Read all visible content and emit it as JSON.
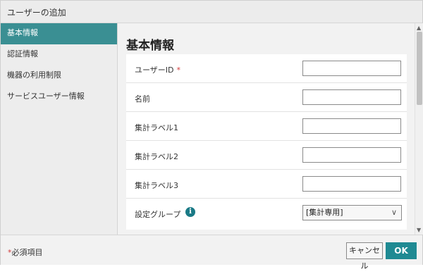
{
  "dialog": {
    "title": "ユーザーの追加"
  },
  "sidebar": {
    "items": [
      {
        "label": "基本情報",
        "active": true
      },
      {
        "label": "認証情報",
        "active": false
      },
      {
        "label": "機器の利用制限",
        "active": false
      },
      {
        "label": "サービスユーザー情報",
        "active": false
      }
    ]
  },
  "main": {
    "section_title": "基本情報",
    "fields": [
      {
        "label": "ユーザーID",
        "required_mark": "*",
        "value": ""
      },
      {
        "label": "名前",
        "value": ""
      },
      {
        "label": "集計ラベル1",
        "value": ""
      },
      {
        "label": "集計ラベル2",
        "value": ""
      },
      {
        "label": "集計ラベル3",
        "value": ""
      },
      {
        "label": "設定グループ",
        "info_icon": "i",
        "select_value": "[集計専用]",
        "chevron": "∨"
      }
    ]
  },
  "scrollbar": {
    "up": "▲",
    "down": "▼"
  },
  "footer": {
    "required_star": "*",
    "required_note": "必須項目",
    "cancel_label": "キャンセル",
    "ok_label": "OK"
  },
  "colors": {
    "accent": "#3a8f93",
    "ok_button": "#1f8a93",
    "required": "#d23a3a",
    "info_icon": "#1a7a86"
  }
}
